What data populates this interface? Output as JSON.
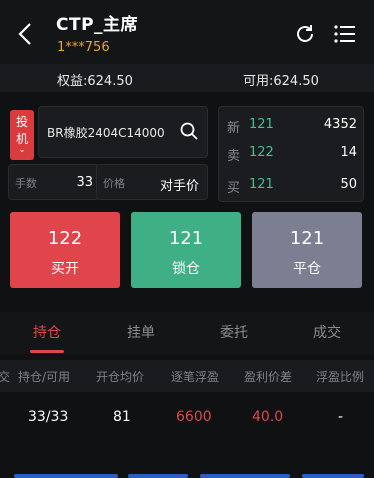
{
  "header": {
    "title": "CTP_主席",
    "account": "1***756",
    "icons": [
      "back-icon",
      "refresh-icon",
      "menu-icon"
    ]
  },
  "summary": {
    "equity": "权益:624.50",
    "available": "可用:624.50"
  },
  "order": {
    "type_tag": [
      "投",
      "机"
    ],
    "contract": "BR橡胶2404C14000",
    "qty_label": "手数",
    "qty_value": "33",
    "price_label": "价格",
    "price_value": "对手价"
  },
  "quote": {
    "rows": [
      {
        "label": "新",
        "price": "121",
        "volume": "4352"
      },
      {
        "label": "卖",
        "price": "122",
        "volume": "14"
      },
      {
        "label": "买",
        "price": "121",
        "volume": "50"
      }
    ]
  },
  "actions": {
    "buy_open": {
      "price": "122",
      "label": "买开"
    },
    "lock": {
      "price": "121",
      "label": "锁仓"
    },
    "close": {
      "price": "121",
      "label": "平仓"
    }
  },
  "tabs": [
    "持仓",
    "挂单",
    "委托",
    "成交"
  ],
  "positions": {
    "columns": [
      "交",
      "持仓/可用",
      "开仓均价",
      "逐笔浮盈",
      "盈利价差",
      "浮盈比例"
    ],
    "rows": [
      {
        "pos": "33/33",
        "avg": "81",
        "pnl": "6600",
        "diff": "40.0",
        "ratio": "-"
      }
    ]
  },
  "colors": {
    "red": "#e0454b",
    "green": "#3fb086",
    "gray": "#7c7e92",
    "gold": "#e3a531"
  }
}
